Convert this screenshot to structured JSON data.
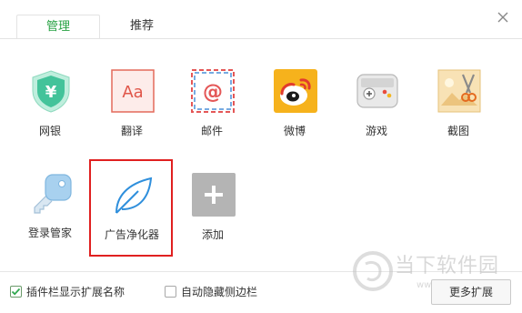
{
  "tabs": [
    {
      "label": "管理",
      "active": true
    },
    {
      "label": "推荐",
      "active": false
    }
  ],
  "apps": [
    {
      "label": "网银",
      "icon": "bank-shield-icon"
    },
    {
      "label": "翻译",
      "icon": "translate-icon"
    },
    {
      "label": "邮件",
      "icon": "mail-icon"
    },
    {
      "label": "微博",
      "icon": "weibo-icon"
    },
    {
      "label": "游戏",
      "icon": "gamepad-icon"
    },
    {
      "label": "截图",
      "icon": "screenshot-icon"
    },
    {
      "label": "登录管家",
      "icon": "key-icon"
    },
    {
      "label": "广告净化器",
      "icon": "leaf-icon"
    },
    {
      "label": "添加",
      "icon": "plus-icon"
    }
  ],
  "icon_text": {
    "translate": "Aa",
    "mail": "@"
  },
  "footer": {
    "show_names_label": "插件栏显示扩展名称",
    "show_names_checked": true,
    "auto_hide_label": "自动隐藏侧边栏",
    "auto_hide_checked": false,
    "more_button": "更多扩展"
  },
  "watermark": {
    "text": "当下软件园",
    "url": "www.downxia.com"
  },
  "colors": {
    "accent_green": "#27a243",
    "highlight_red": "#e02020"
  }
}
